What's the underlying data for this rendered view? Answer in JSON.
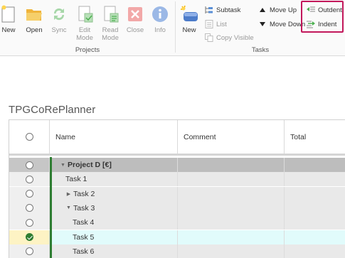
{
  "ribbon": {
    "projects_group": {
      "label": "Projects",
      "buttons": [
        {
          "id": "new",
          "label": "New",
          "icon": "new-project-icon",
          "enabled": true
        },
        {
          "id": "open",
          "label": "Open",
          "icon": "folder-open-icon",
          "enabled": true
        },
        {
          "id": "sync",
          "label": "Sync",
          "icon": "sync-icon",
          "enabled": false
        },
        {
          "id": "edit_mode",
          "label": "Edit\nMode",
          "icon": "edit-mode-icon",
          "enabled": false
        },
        {
          "id": "read_mode",
          "label": "Read\nMode",
          "icon": "read-mode-icon",
          "enabled": false
        },
        {
          "id": "close",
          "label": "Close",
          "icon": "close-icon",
          "enabled": false
        },
        {
          "id": "info",
          "label": "Info",
          "icon": "info-icon",
          "enabled": false
        }
      ]
    },
    "tasks_group": {
      "label": "Tasks",
      "new_label": "New",
      "subtask_label": "Subtask",
      "list_label": "List",
      "copy_visible_label": "Copy Visible",
      "move_up_label": "Move Up",
      "move_down_label": "Move Down",
      "outdent_label": "Outdent",
      "indent_label": "Indent"
    },
    "colors": {
      "highlight_box": "#c2185b",
      "accent_green": "#2e7d32"
    }
  },
  "app": {
    "title": "TPGCoRePlanner"
  },
  "grid": {
    "columns": [
      {
        "id": "select",
        "label": ""
      },
      {
        "id": "name",
        "label": "Name"
      },
      {
        "id": "comment",
        "label": "Comment"
      },
      {
        "id": "total",
        "label": "Total"
      }
    ],
    "rows": [
      {
        "name": "Project D [€]",
        "level": 0,
        "expander": "expanded",
        "summary": true,
        "selected": false,
        "comment": "",
        "total": ""
      },
      {
        "name": "Task 1",
        "level": 1,
        "expander": "none",
        "summary": false,
        "selected": false,
        "comment": "",
        "total": ""
      },
      {
        "name": "Task 2",
        "level": 1,
        "expander": "collapsed",
        "summary": false,
        "selected": false,
        "comment": "",
        "total": ""
      },
      {
        "name": "Task 3",
        "level": 1,
        "expander": "expanded",
        "summary": false,
        "selected": false,
        "comment": "",
        "total": ""
      },
      {
        "name": "Task 4",
        "level": 2,
        "expander": "none",
        "summary": false,
        "selected": false,
        "comment": "",
        "total": ""
      },
      {
        "name": "Task 5",
        "level": 2,
        "expander": "none",
        "summary": false,
        "selected": true,
        "comment": "",
        "total": ""
      },
      {
        "name": "Task 6",
        "level": 2,
        "expander": "none",
        "summary": false,
        "selected": false,
        "comment": "",
        "total": ""
      }
    ]
  }
}
